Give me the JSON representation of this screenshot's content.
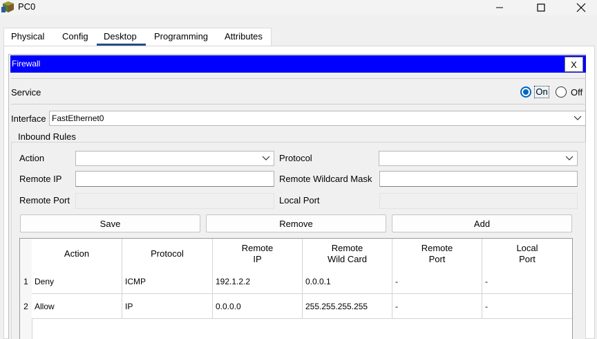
{
  "window": {
    "title": "PC0",
    "icon": "pc-app-icon"
  },
  "tabs": [
    {
      "label": "Physical"
    },
    {
      "label": "Config"
    },
    {
      "label": "Desktop",
      "active": true
    },
    {
      "label": "Programming"
    },
    {
      "label": "Attributes"
    }
  ],
  "firewall": {
    "title": "Firewall",
    "close_label": "X"
  },
  "service": {
    "label": "Service",
    "on_label": "On",
    "off_label": "Off",
    "selected": "On"
  },
  "interface": {
    "label": "Interface",
    "value": "FastEthernet0"
  },
  "inbound": {
    "title": "Inbound Rules",
    "action_label": "Action",
    "action_value": "",
    "protocol_label": "Protocol",
    "protocol_value": "",
    "remote_ip_label": "Remote IP",
    "remote_ip_value": "",
    "remote_wildcard_label": "Remote Wildcard Mask",
    "remote_wildcard_value": "",
    "remote_port_label": "Remote Port",
    "local_port_label": "Local Port",
    "save_label": "Save",
    "remove_label": "Remove",
    "add_label": "Add"
  },
  "table": {
    "columns": [
      {
        "line1": "Action",
        "line2": ""
      },
      {
        "line1": "Protocol",
        "line2": ""
      },
      {
        "line1": "Remote",
        "line2": "IP"
      },
      {
        "line1": "Remote",
        "line2": "Wild Card"
      },
      {
        "line1": "Remote",
        "line2": "Port"
      },
      {
        "line1": "Local",
        "line2": "Port"
      }
    ],
    "rows": [
      {
        "num": "1",
        "cells": [
          "Deny",
          "ICMP",
          "192.1.2.2",
          "0.0.0.1",
          "-",
          "-"
        ]
      },
      {
        "num": "2",
        "cells": [
          "Allow",
          "IP",
          "0.0.0.0",
          "255.255.255.255",
          "-",
          "-"
        ]
      }
    ]
  },
  "colors": {
    "header_bg": "#0000ff",
    "header_text": "#ffffff",
    "radio_accent": "#0067c0",
    "tab_underline": "#2b4a8a"
  }
}
